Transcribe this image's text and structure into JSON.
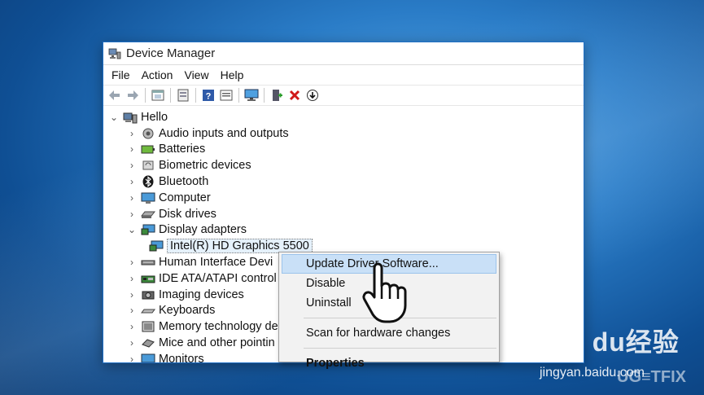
{
  "window": {
    "title": "Device Manager"
  },
  "menu": [
    "File",
    "Action",
    "View",
    "Help"
  ],
  "toolbar_icons": [
    "back-icon",
    "forward-icon",
    "properties-pane-icon",
    "show-hidden-icon",
    "help-icon",
    "view-icon",
    "monitor-icon",
    "add-driver-icon",
    "remove-icon",
    "download-icon"
  ],
  "tree": {
    "root": "Hello",
    "items": [
      {
        "label": "Audio inputs and outputs",
        "expanded": false
      },
      {
        "label": "Batteries",
        "expanded": false
      },
      {
        "label": "Biometric devices",
        "expanded": false
      },
      {
        "label": "Bluetooth",
        "expanded": false
      },
      {
        "label": "Computer",
        "expanded": false
      },
      {
        "label": "Disk drives",
        "expanded": false
      },
      {
        "label": "Display adapters",
        "expanded": true
      },
      {
        "label": "Intel(R) HD Graphics 5500",
        "child": true
      },
      {
        "label": "Human Interface Devi",
        "expanded": false
      },
      {
        "label": "IDE ATA/ATAPI control",
        "expanded": false
      },
      {
        "label": "Imaging devices",
        "expanded": false
      },
      {
        "label": "Keyboards",
        "expanded": false
      },
      {
        "label": "Memory technology de",
        "expanded": false
      },
      {
        "label": "Mice and other pointin",
        "expanded": false
      },
      {
        "label": "Monitors",
        "expanded": false
      }
    ]
  },
  "context_menu": {
    "update": "Update Driver Software...",
    "disable": "Disable",
    "uninstall": "Uninstall",
    "scan": "Scan for hardware changes",
    "properties": "Properties"
  },
  "watermark": {
    "baidu": "Bai du经验",
    "baidu_url": "jingyan.baidu.com",
    "ugetfix": "UG≡TFIX"
  },
  "colors": {
    "titlebar_border": "#1f6fc4",
    "menu_highlight": "#c9e0f7"
  }
}
